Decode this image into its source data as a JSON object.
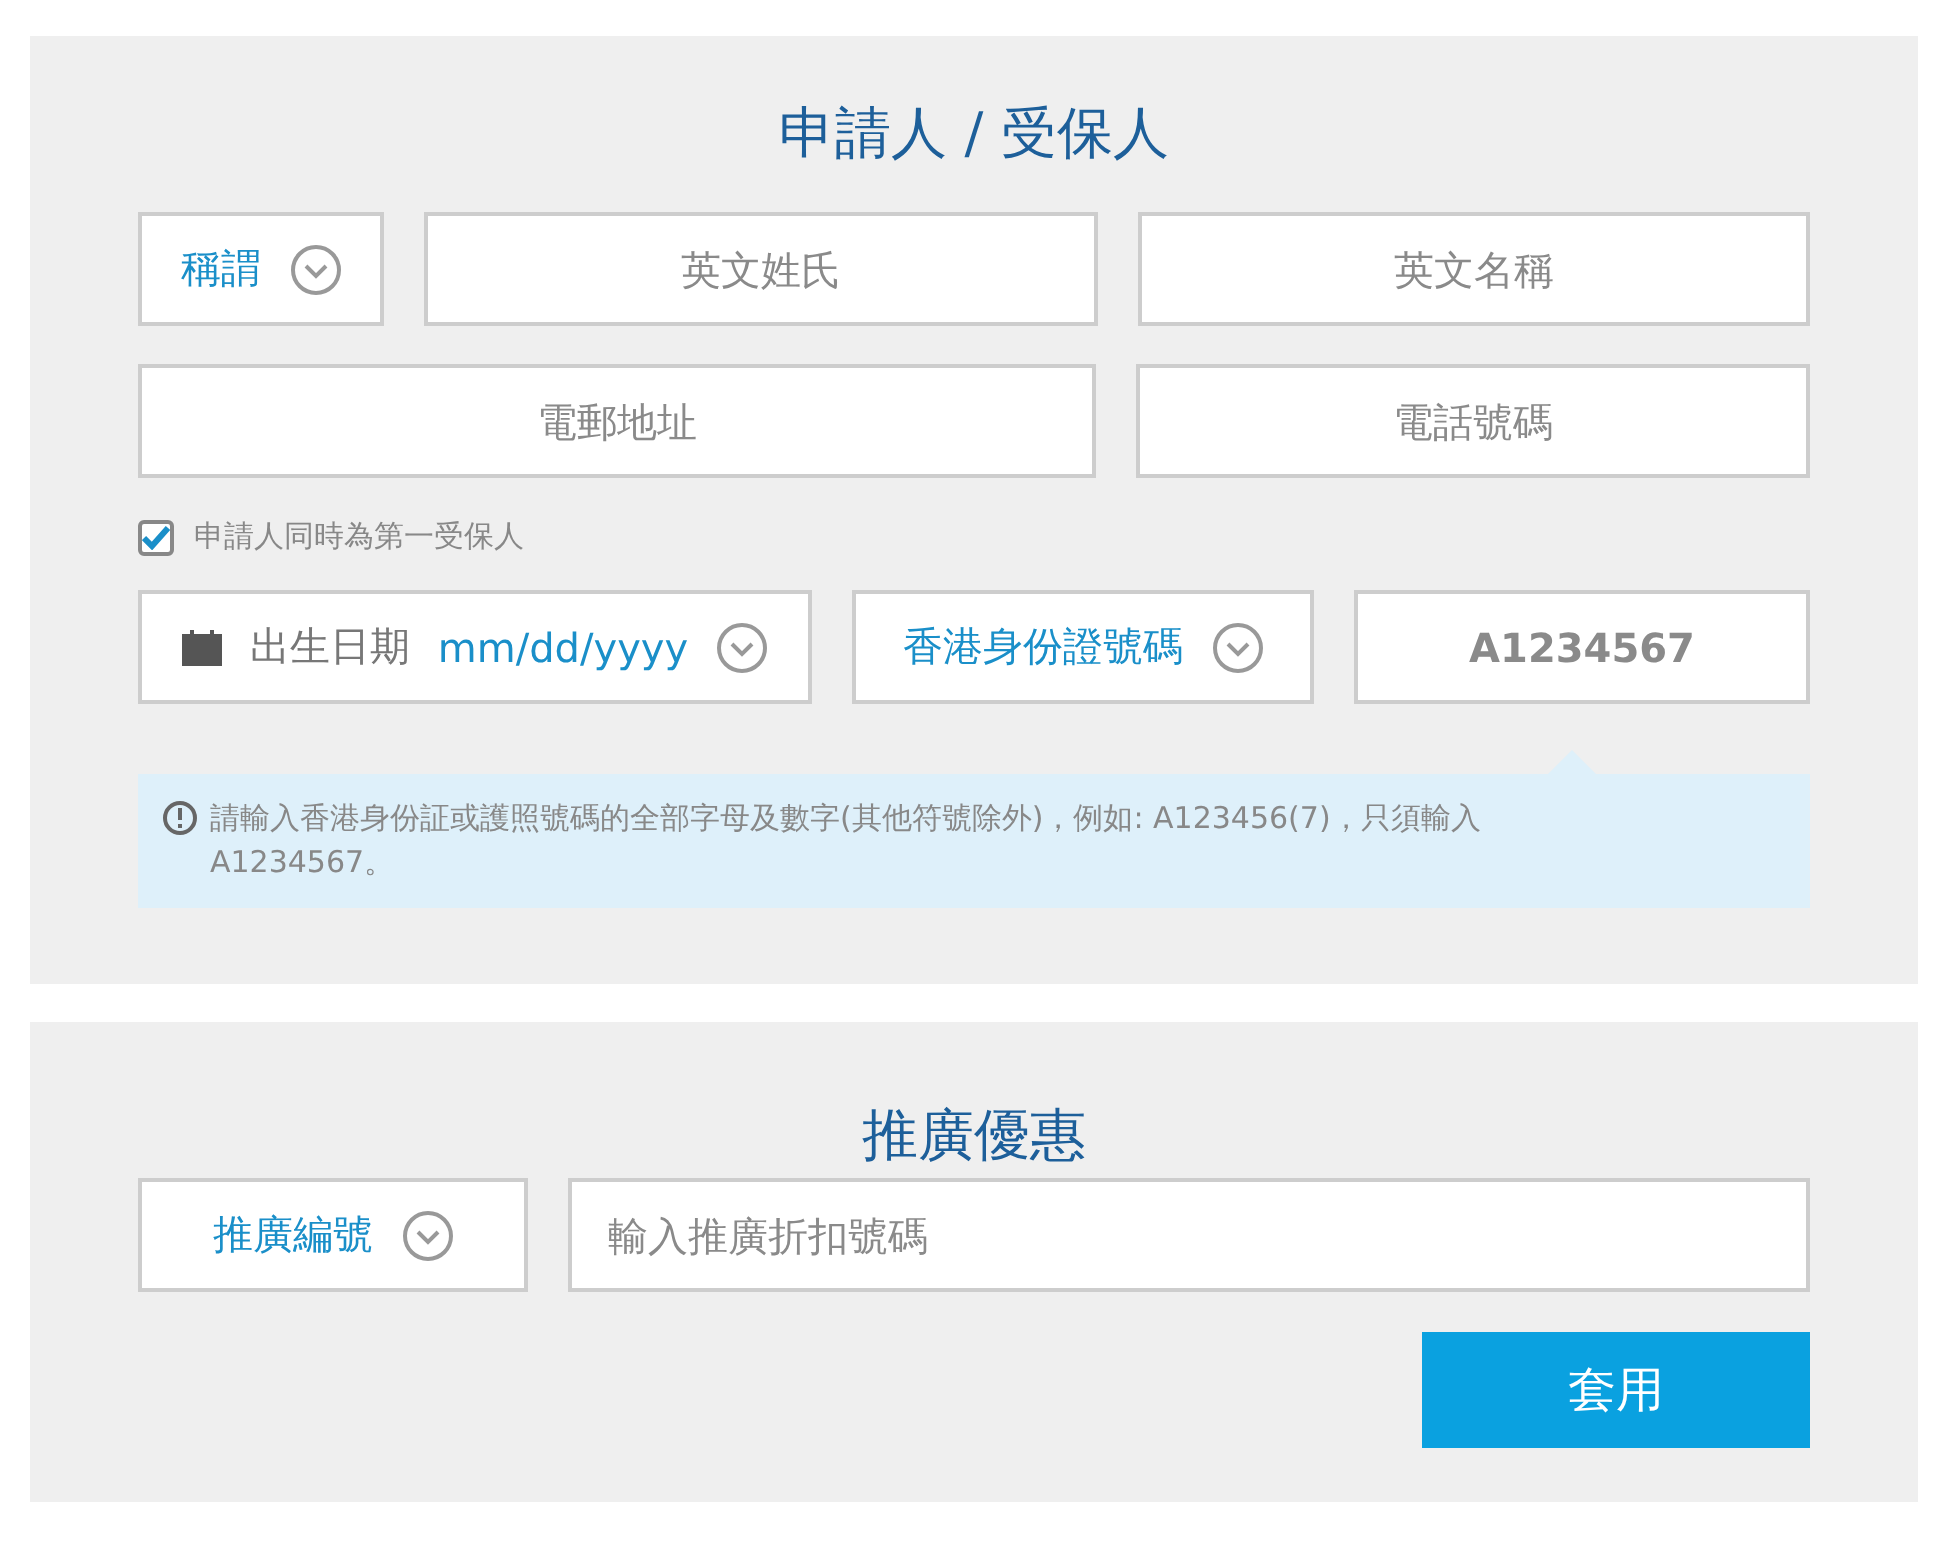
{
  "applicant": {
    "title": "申請人 / 受保人",
    "salutation": {
      "label": "稱謂"
    },
    "fields": [
      {
        "placeholder": "英文姓氏"
      },
      {
        "placeholder": "英文名稱"
      },
      {
        "placeholder": "電郵地址"
      },
      {
        "placeholder": "電話號碼"
      }
    ],
    "same_as_insured": {
      "label": "申請人同時為第一受保人",
      "checked": true
    },
    "birth_date": {
      "label": "出生日期",
      "placeholder": "mm/dd/yyyy"
    },
    "id_type": {
      "label": "香港身份證號碼"
    },
    "id_number": {
      "value": "A1234567"
    },
    "hint": "請輸入香港身份証或護照號碼的全部字母及數字(其他符號除外)，例如: A123456(7)，只須輸入A1234567。"
  },
  "promotion": {
    "title": "推廣優惠",
    "code_type": {
      "label": "推廣編號"
    },
    "code": {
      "placeholder": "輸入推廣折扣號碼"
    },
    "apply_button": "套用"
  }
}
